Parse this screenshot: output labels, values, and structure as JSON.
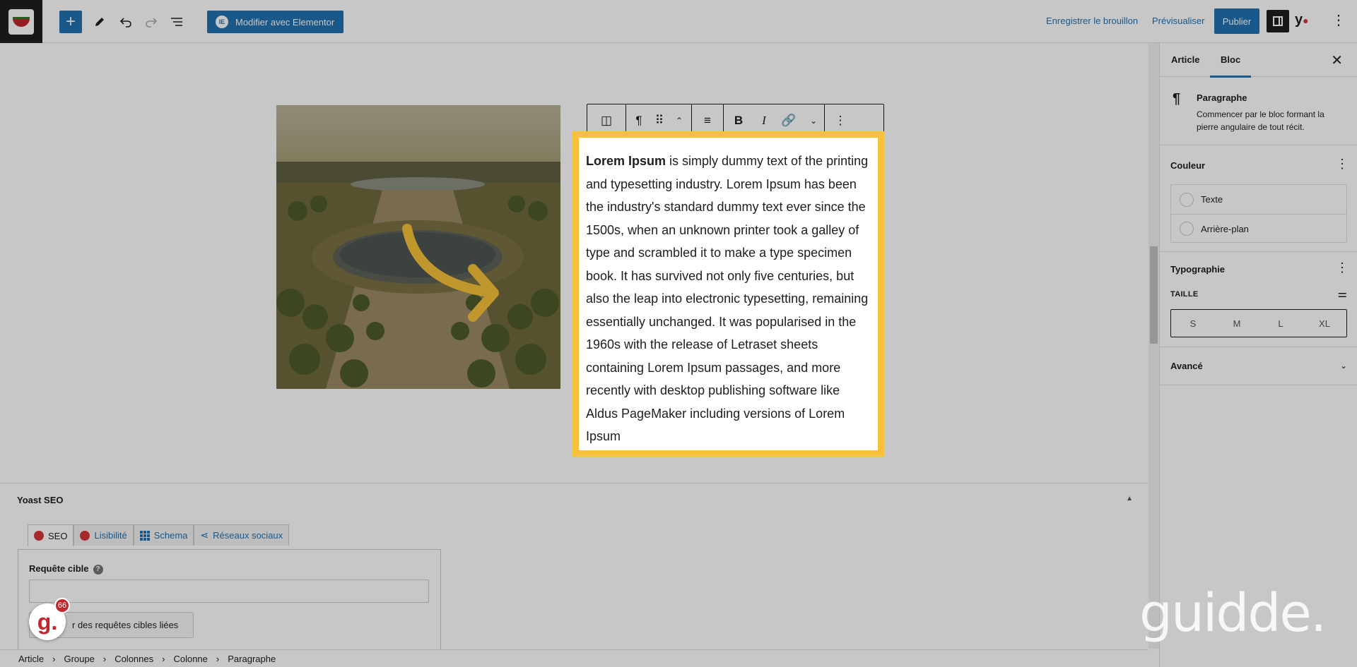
{
  "topbar": {
    "elementor_label": "Modifier avec Elementor",
    "elementor_icon": "IE",
    "save_draft": "Enregistrer le brouillon",
    "preview": "Prévisualiser",
    "publish": "Publier",
    "yoast_label": "y"
  },
  "editor": {
    "paragraph_bold": "Lorem Ipsum",
    "paragraph_rest": " is simply dummy text of the printing and typesetting industry. Lorem Ipsum has been the industry's standard dummy text ever since the 1500s, when an unknown printer took a galley of type and scrambled it to make a type specimen book. It has survived not only five centuries, but also the leap into electronic typesetting, remaining essentially unchanged. It was popularised in the 1960s with the release of Letraset sheets containing Lorem Ipsum passages, and more recently with desktop publishing software like Aldus PageMaker including versions of Lorem Ipsum",
    "highlight_color": "#f7c23a",
    "arrow_color": "#f7c23a"
  },
  "yoast": {
    "title": "Yoast SEO",
    "tabs": [
      {
        "label": "SEO"
      },
      {
        "label": "Lisibilité"
      },
      {
        "label": "Schema"
      },
      {
        "label": "Réseaux sociaux"
      }
    ],
    "focus_label": "Requête cible",
    "related_button": "r des requêtes cibles liées"
  },
  "breadcrumb": [
    "Article",
    "Groupe",
    "Colonnes",
    "Colonne",
    "Paragraphe"
  ],
  "sidebar": {
    "tabs": [
      "Article",
      "Bloc"
    ],
    "block_title": "Paragraphe",
    "block_desc": "Commencer par le bloc formant la pierre angulaire de tout récit.",
    "color_title": "Couleur",
    "colors": [
      "Texte",
      "Arrière-plan"
    ],
    "typo_title": "Typographie",
    "size_label": "TAILLE",
    "sizes": [
      "S",
      "M",
      "L",
      "XL"
    ],
    "advanced_title": "Avancé"
  },
  "guidde": {
    "badge_letter": "g.",
    "badge_count": "66",
    "logo_text": "guidde."
  },
  "colors": {
    "accent": "#2271b1",
    "brand_red": "#c0262b"
  }
}
